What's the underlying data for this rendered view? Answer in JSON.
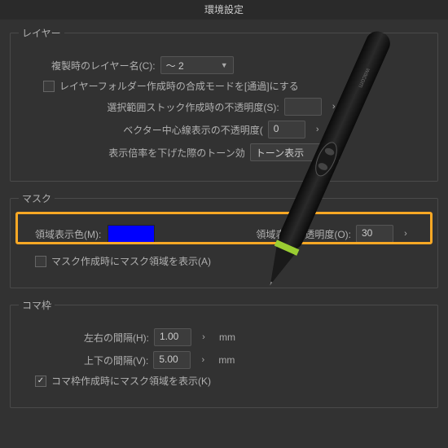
{
  "title": "環境設定",
  "layer": {
    "legend": "レイヤー",
    "dup_name_label": "複製時のレイヤー名(C):",
    "dup_name_value": "～ 2",
    "folder_blend_label": "レイヤーフォルダー作成時の合成モードを[通過]にする",
    "stock_opacity_label": "選択範囲ストック作成時の不透明度(S):",
    "stock_opacity_value": "",
    "vector_center_label": "ベクター中心線表示の不透明度(",
    "vector_center_value": "0",
    "tone_label": "表示倍率を下げた際のトーン効",
    "tone_value": "トーン表示"
  },
  "mask": {
    "legend": "マスク",
    "area_color_label": "領域表示色(M):",
    "area_color_value": "#0000ff",
    "area_opacity_label": "領域表示不透明度(O):",
    "area_opacity_value": "30",
    "show_on_create_label": "マスク作成時にマスク領域を表示(A)"
  },
  "frame": {
    "legend": "コマ枠",
    "h_gap_label": "左右の間隔(H):",
    "h_gap_value": "1.00",
    "v_gap_label": "上下の間隔(V):",
    "v_gap_value": "5.00",
    "unit": "mm",
    "show_mask_label": "コマ枠作成時にマスク領域を表示(K)",
    "show_mask_checked": "✓"
  }
}
